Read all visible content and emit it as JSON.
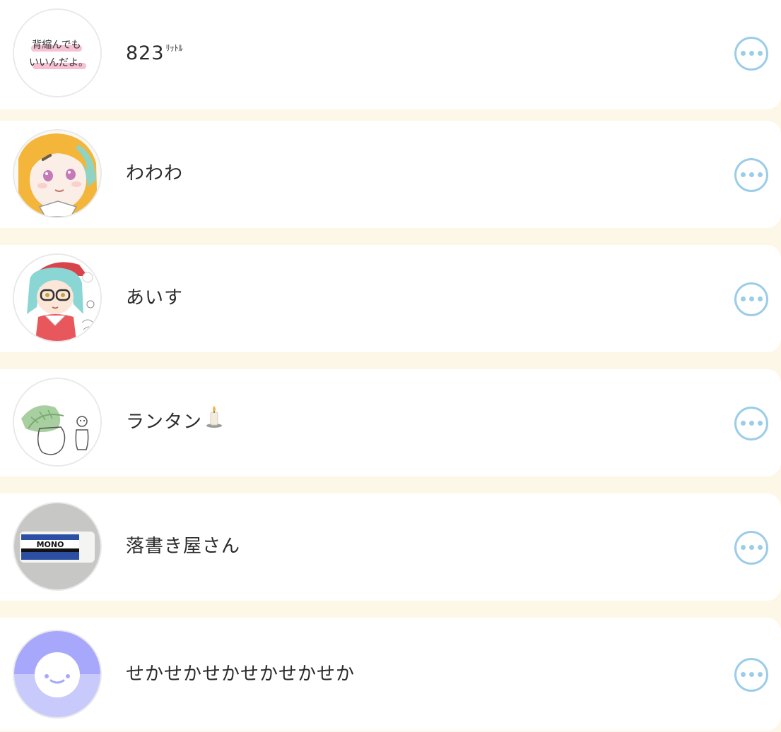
{
  "users": [
    {
      "name": "823",
      "name_suffix": "ﾘｯﾄﾙ",
      "avatar": "avatar-text-image",
      "avatar_text_line1": "背縮んでも",
      "avatar_text_line2": "いいんだよ。"
    },
    {
      "name": "わわわ",
      "avatar": "avatar-anime-girl-blonde"
    },
    {
      "name": "あいす",
      "avatar": "avatar-anime-girl-santa"
    },
    {
      "name": "ランタン",
      "avatar": "avatar-leaf-sketch",
      "trailing_icon": "candle-icon"
    },
    {
      "name": "落書き屋さん",
      "avatar": "avatar-eraser-photo",
      "avatar_text": "MONO"
    },
    {
      "name": "せかせかせかせかせかせか",
      "avatar": "avatar-default-smiley"
    }
  ],
  "more_button_icon": "more-options-icon",
  "colors": {
    "background": "#fdf7e8",
    "row": "#ffffff",
    "accent": "#9bcde9",
    "text": "#2a2a2a",
    "default_avatar": "#a7a8fb"
  }
}
